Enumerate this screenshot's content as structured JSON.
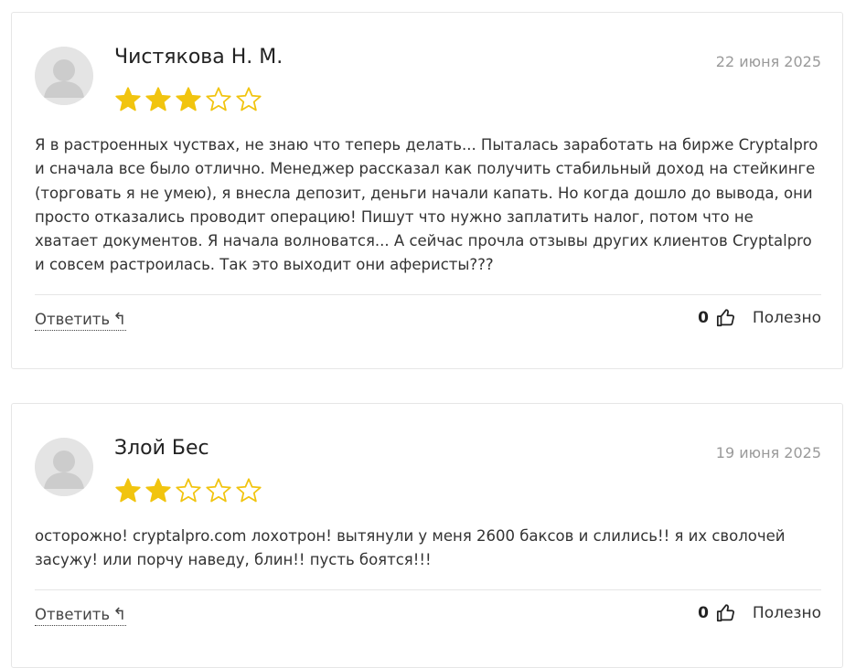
{
  "colors": {
    "star_filled": "#f1c40f",
    "star_empty_outline": "#f1c40f",
    "date_text": "#9a9a9a",
    "card_border": "#e6e6e6"
  },
  "reviews": [
    {
      "author": "Чистякова Н. М.",
      "date": "22 июня 2025",
      "rating": 3,
      "rating_max": 5,
      "text": "Я в растроенных чуствах, не знаю что теперь делать... Пыталась заработать на бирже Cryptalpro и сначала все было отлично. Менеджер рассказал как получить стабильный доход на стейкинге (торговать я не умею), я внесла депозит, деньги начали капать. Но когда дошло до вывода, они просто отказались проводит операцию! Пишут что нужно заплатить налог, потом что не хватает документов. Я начала волноватся... А сейчас прочла отзывы других клиентов Cryptalpro и совсем растроилась. Так это выходит они аферисты???",
      "reply_label": "Ответить",
      "reply_icon": "reply-arrow-icon",
      "likes": "0",
      "like_icon": "thumbs-up-icon",
      "helpful_label": "Полезно"
    },
    {
      "author": "Злой Бес",
      "date": "19 июня 2025",
      "rating": 2,
      "rating_max": 5,
      "text": "осторожно! cryptalpro.com лохотрон! вытянули у меня 2600 баксов и слились!! я их сволочей засужу! или порчу наведу, блин!! пусть боятся!!!",
      "reply_label": "Ответить",
      "reply_icon": "reply-arrow-icon",
      "likes": "0",
      "like_icon": "thumbs-up-icon",
      "helpful_label": "Полезно"
    }
  ]
}
